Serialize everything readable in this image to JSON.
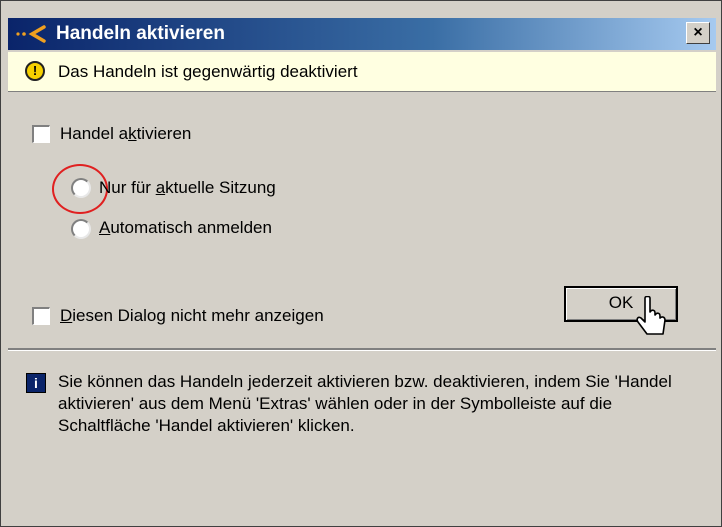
{
  "window": {
    "title": "Handeln aktivieren",
    "close_glyph": "×"
  },
  "infobar": {
    "icon": "warning-icon",
    "text": "Das Handeln ist gegenwärtig deaktiviert"
  },
  "options": {
    "activate_checkbox": {
      "label_pre": "Handel a",
      "label_ul": "k",
      "label_post": "tivieren",
      "checked": false
    },
    "radio_session": {
      "label_pre": "Nur für ",
      "label_ul": "a",
      "label_post": "ktuelle Sitzung",
      "selected": false
    },
    "radio_auto": {
      "label_pre": "",
      "label_ul": "A",
      "label_post": "utomatisch anmelden",
      "selected": false
    },
    "dont_show_checkbox": {
      "label_pre": "",
      "label_ul": "D",
      "label_post": "iesen Dialog nicht mehr anzeigen",
      "checked": false
    }
  },
  "buttons": {
    "ok_label": "OK"
  },
  "footer": {
    "icon": "info-icon",
    "icon_glyph": "i",
    "text": "Sie können das Handeln jederzeit aktivieren bzw. deaktivieren, indem Sie 'Handel aktivieren' aus dem Menü 'Extras' wählen oder in der Symbolleiste auf die Schaltfläche 'Handel aktivieren' klicken."
  },
  "colors": {
    "titlebar_start": "#0a246a",
    "titlebar_end": "#a6caf0",
    "infobar_bg": "#ffffe1",
    "highlight": "#e02020"
  }
}
